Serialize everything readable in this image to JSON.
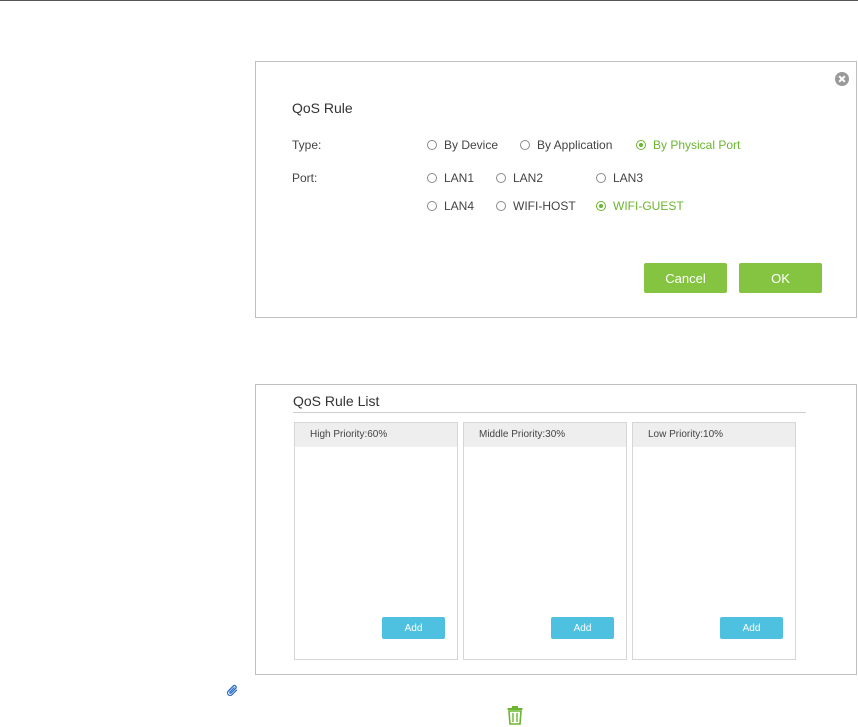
{
  "dialog": {
    "title": "QoS Rule",
    "type_label": "Type:",
    "type_options": [
      "By Device",
      "By Application",
      "By Physical Port"
    ],
    "type_selected": "By Physical Port",
    "port_label": "Port:",
    "port_options": [
      "LAN1",
      "LAN2",
      "LAN3",
      "LAN4",
      "WIFI-HOST",
      "WIFI-GUEST"
    ],
    "port_selected": "WIFI-GUEST",
    "cancel_label": "Cancel",
    "ok_label": "OK"
  },
  "rule_list": {
    "title": "QoS Rule List",
    "columns": [
      {
        "label": "High Priority:60%",
        "add_label": "Add"
      },
      {
        "label": "Middle Priority:30%",
        "add_label": "Add"
      },
      {
        "label": "Low Priority:10%",
        "add_label": "Add"
      }
    ]
  },
  "colors": {
    "accent_green": "#6bb52f",
    "button_green": "#85c440",
    "add_blue": "#4fc1e0"
  },
  "icons": [
    "close-icon",
    "paperclip-icon",
    "trash-icon"
  ]
}
